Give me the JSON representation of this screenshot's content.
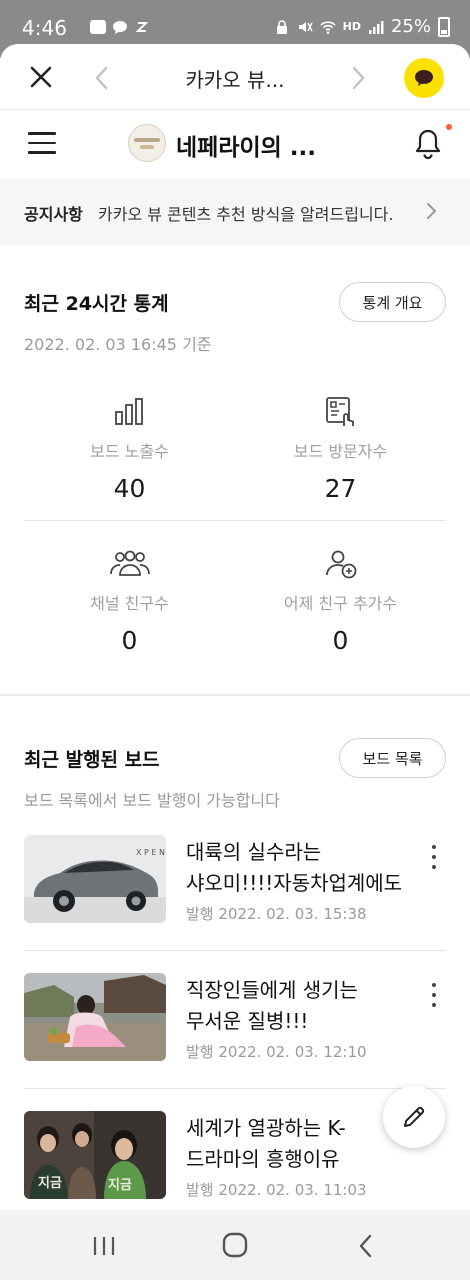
{
  "status_bar": {
    "time": "4:46",
    "battery": "25%",
    "network": "HD",
    "notification_badge": "My"
  },
  "header": {
    "title": "카카오 뷰..."
  },
  "channel": {
    "name": "네페라이의 ...",
    "has_new_notification": true
  },
  "notice": {
    "label": "공지사항",
    "text": "카카오 뷰 콘텐츠 추천 방식을 알려드립니다."
  },
  "stats": {
    "title": "최근 24시간 통계",
    "overview_button": "통계 개요",
    "as_of": "2022. 02. 03 16:45 기준",
    "items": [
      {
        "icon": "bar-chart-icon",
        "label": "보드 노출수",
        "value": "40"
      },
      {
        "icon": "board-visit-icon",
        "label": "보드 방문자수",
        "value": "27"
      },
      {
        "icon": "people-group-icon",
        "label": "채널 친구수",
        "value": "0"
      },
      {
        "icon": "add-friend-icon",
        "label": "어제 친구 추가수",
        "value": "0"
      }
    ]
  },
  "boards": {
    "title": "최근 발행된 보드",
    "list_button": "보드 목록",
    "subtitle": "보드 목록에서 보드 발행이 가능합니다",
    "items": [
      {
        "title": "대륙의 실수라는 샤오미!!!!자동차업계에도 대...",
        "date": "발행 2022. 02. 03. 15:38",
        "thumb": "car"
      },
      {
        "title": "직장인들에게 생기는 무서운 질병!!!",
        "date": "발행 2022. 02. 03. 12:10",
        "thumb": "woman"
      },
      {
        "title": "세계가 열광하는 K-드라마의 흥행이유",
        "date": "발행 2022. 02. 03. 11:03",
        "thumb": "drama"
      }
    ]
  },
  "colors": {
    "kakao_yellow": "#fae100",
    "notification_dot": "#ff5a3a",
    "muted_text": "#9a9a9a"
  }
}
